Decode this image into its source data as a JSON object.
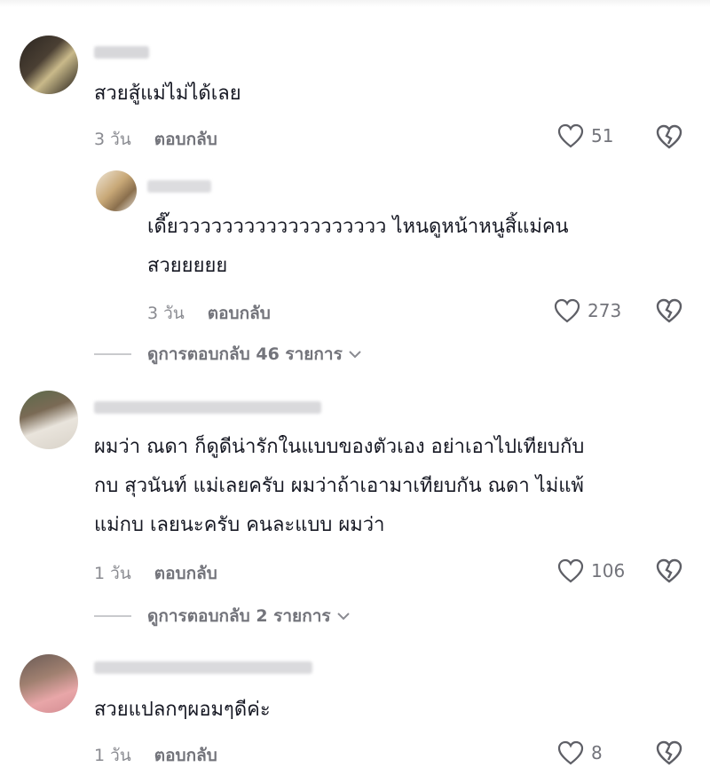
{
  "comments": [
    {
      "text": [
        "สวยสู้แม่ไม่ได้เลย"
      ],
      "time": "3 วัน",
      "reply_label": "ตอบกลับ",
      "likes": "51",
      "reply": {
        "text": [
          "เดี๊ยววววววววววววววววววว ไหนดูหน้าหนูสิ้แม่คน",
          "สวยยยยย"
        ],
        "time": "3 วัน",
        "reply_label": "ตอบกลับ",
        "likes": "273"
      },
      "view_replies": "ดูการตอบกลับ 46 รายการ"
    },
    {
      "text": [
        "ผมว่า ณดา ก็ดูดีน่ารักในแบบของตัวเอง อย่าเอาไปเทียบกับ",
        "กบ สุวนันท์ แม่เลยครับ ผมว่าถ้าเอามาเทียบกัน ณดา ไม่แพ้",
        "แม่กบ เลยนะครับ คนละแบบ ผมว่า"
      ],
      "time": "1 วัน",
      "reply_label": "ตอบกลับ",
      "likes": "106",
      "view_replies": "ดูการตอบกลับ 2 รายการ"
    },
    {
      "text": [
        "สวยแปลกๆผอมๆดีค่ะ"
      ],
      "time": "1 วัน",
      "reply_label": "ตอบกลับ",
      "likes": "8"
    }
  ],
  "icons": {
    "like": "heart-outline-icon",
    "dislike": "broken-heart-icon",
    "expand": "chevron-down-icon"
  },
  "colors": {
    "text": "#161823",
    "muted": "#8a8b91",
    "secondary": "#73747b"
  }
}
